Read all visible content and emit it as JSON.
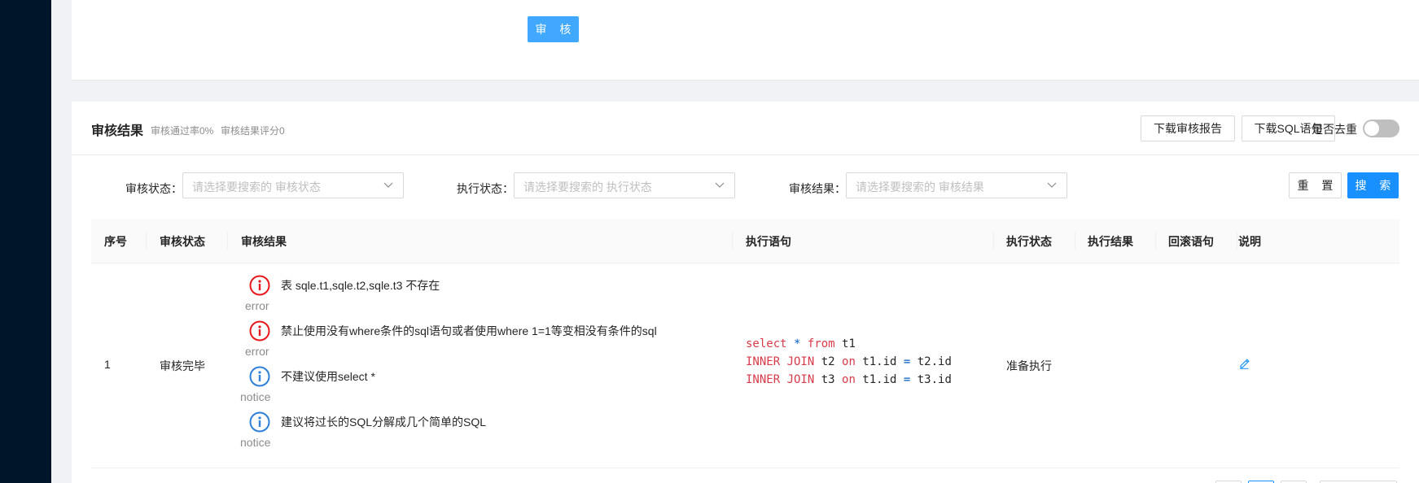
{
  "top_card": {
    "audit_button": "审 核"
  },
  "result_card": {
    "title": "审核结果",
    "pass_rate": "审核通过率0%",
    "score": "审核结果评分0",
    "download_report": "下载审核报告",
    "download_sql": "下载SQL语句",
    "dedup_label": "是否去重",
    "dedup_enabled": false
  },
  "filters": [
    {
      "label": "审核状态：",
      "placeholder": "请选择要搜索的 审核状态"
    },
    {
      "label": "执行状态：",
      "placeholder": "请选择要搜索的 执行状态"
    },
    {
      "label": "审核结果：",
      "placeholder": "请选择要搜索的 审核结果"
    }
  ],
  "buttons": {
    "reset": "重 置",
    "search": "搜 索"
  },
  "table": {
    "columns": [
      "序号",
      "审核状态",
      "审核结果",
      "执行语句",
      "执行状态",
      "执行结果",
      "回滚语句",
      "说明"
    ],
    "rows": [
      {
        "index": "1",
        "audit_status": "审核完毕",
        "results": [
          {
            "text": "表 sqle.t1,sqle.t2,sqle.t3 不存在",
            "level": "error"
          },
          {
            "text": "禁止使用没有where条件的sql语句或者使用where 1=1等变相没有条件的sql",
            "level": "error"
          },
          {
            "text": "不建议使用select *",
            "level": "notice"
          },
          {
            "text": "建议将过长的SQL分解成几个简单的SQL",
            "level": "notice"
          }
        ],
        "exec_status": "准备执行",
        "exec_result": "",
        "rollback": "",
        "sql_lines": [
          [
            {
              "t": "select",
              "c": "kw"
            },
            {
              "t": " "
            },
            {
              "t": "*",
              "c": "op"
            },
            {
              "t": " "
            },
            {
              "t": "from",
              "c": "kw"
            },
            {
              "t": " t1"
            }
          ],
          [
            {
              "t": "INNER JOIN",
              "c": "kw"
            },
            {
              "t": " t2 "
            },
            {
              "t": "on",
              "c": "kw"
            },
            {
              "t": " t1.id "
            },
            {
              "t": "=",
              "c": "op"
            },
            {
              "t": " t2.id"
            }
          ],
          [
            {
              "t": "INNER JOIN",
              "c": "kw"
            },
            {
              "t": " t3 "
            },
            {
              "t": "on",
              "c": "kw"
            },
            {
              "t": " t1.id "
            },
            {
              "t": "=",
              "c": "op"
            },
            {
              "t": " t3.id"
            }
          ]
        ]
      }
    ]
  },
  "colors": {
    "error": "#e8181c",
    "notice": "#2f80d9",
    "primary": "#1890ff",
    "sidebar": "#001529"
  },
  "icons": [
    "error-info-icon",
    "notice-info-icon",
    "edit-icon",
    "chevron-down-icon"
  ]
}
